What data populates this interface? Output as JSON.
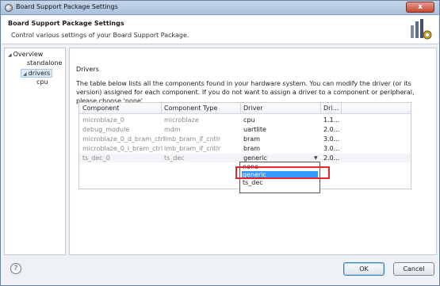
{
  "window": {
    "title": "Board Support Package Settings",
    "close_label": "x"
  },
  "header": {
    "title": "Board Support Package Settings",
    "subtitle": "Control various settings of your Board Support Package."
  },
  "tree": {
    "items": [
      {
        "label": "Overview",
        "expanded": true
      },
      {
        "label": "standalone"
      },
      {
        "label": "drivers",
        "expanded": true,
        "selected": true
      },
      {
        "label": "cpu"
      }
    ]
  },
  "drivers": {
    "section_label": "Drivers",
    "description": "The table below lists all the components found in your hardware system. You can modify the driver (or its version) assigned for each component. If you do not want to assign a driver to a component or peripheral, please choose 'none'.",
    "columns": [
      "Component",
      "Component Type",
      "Driver",
      "Dri..."
    ],
    "rows": [
      {
        "component": "microblaze_0",
        "type": "microblaze",
        "driver": "cpu",
        "version": "1.1..."
      },
      {
        "component": "debug_module",
        "type": "mdm",
        "driver": "uartlite",
        "version": "2.0..."
      },
      {
        "component": "microblaze_0_d_bram_ctrl",
        "type": "lmb_bram_if_cntlr",
        "driver": "bram",
        "version": "3.0..."
      },
      {
        "component": "microblaze_0_i_bram_ctrl",
        "type": "lmb_bram_if_cntlr",
        "driver": "bram",
        "version": "3.0..."
      },
      {
        "component": "ts_dec_0",
        "type": "ts_dec",
        "driver": "generic",
        "version": "2.0..."
      }
    ],
    "dropdown_options": [
      "none",
      "generic",
      "ts_dec"
    ],
    "dropdown_highlighted": "generic"
  },
  "footer": {
    "help_label": "?",
    "ok_label": "OK",
    "cancel_label": "Cancel"
  },
  "colors": {
    "highlight": "#3399ff",
    "annotation": "#e8262f"
  }
}
